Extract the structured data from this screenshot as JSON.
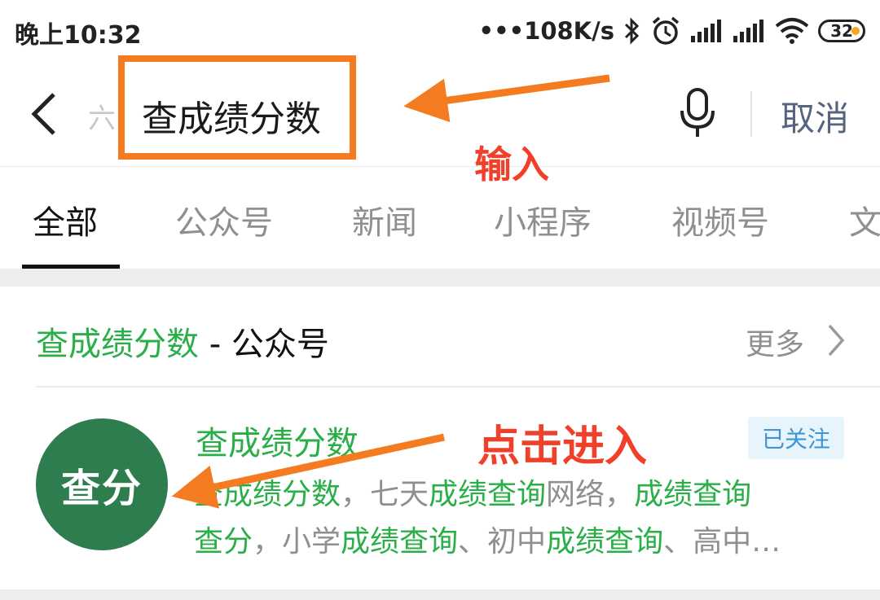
{
  "status_bar": {
    "time": "晚上10:32",
    "net_speed": "•••108K/s",
    "battery": "32",
    "icons": [
      "bluetooth-icon",
      "alarm-icon",
      "signal-icon",
      "signal-icon",
      "wifi-icon",
      "battery-icon"
    ]
  },
  "search": {
    "placeholder_ghost": "六",
    "query": "查成绩分数",
    "cancel_label": "取消"
  },
  "tabs": [
    {
      "label": "全部",
      "active": true
    },
    {
      "label": "公众号"
    },
    {
      "label": "新闻"
    },
    {
      "label": "小程序"
    },
    {
      "label": "视频号"
    },
    {
      "label": "文"
    }
  ],
  "section": {
    "title_keyword": "查成绩分数",
    "title_suffix": " - 公众号",
    "more_label": "更多"
  },
  "result": {
    "avatar_text": "查分",
    "name": "查成绩分数",
    "badge": "已关注",
    "desc_line1": [
      {
        "text": "查成绩分数",
        "hl": true
      },
      {
        "text": "，七天",
        "hl": false
      },
      {
        "text": "成绩查询",
        "hl": true
      },
      {
        "text": "网络，",
        "hl": false
      },
      {
        "text": "成绩查询",
        "hl": true
      }
    ],
    "desc_line2": [
      {
        "text": "查分",
        "hl": true
      },
      {
        "text": "，小学",
        "hl": false
      },
      {
        "text": "成绩查询",
        "hl": true
      },
      {
        "text": "、初中",
        "hl": false
      },
      {
        "text": "成绩查询",
        "hl": true
      },
      {
        "text": "、高中…",
        "hl": false
      }
    ]
  },
  "annotations": {
    "input": "输入",
    "enter": "点击进入"
  },
  "colors": {
    "accent_green": "#2aae48",
    "annotation_orange": "#f47b20",
    "annotation_red": "#f0402a",
    "avatar_bg": "#2e7d4f",
    "cancel_text": "#56657d"
  }
}
